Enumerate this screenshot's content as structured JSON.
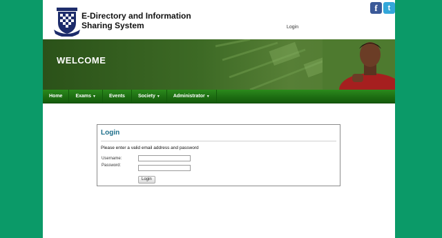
{
  "header": {
    "title": "E-Directory and Information Sharing System",
    "login_link": "Login",
    "social": {
      "facebook": "f",
      "twitter": "t"
    }
  },
  "banner": {
    "title": "WELCOME"
  },
  "nav": {
    "items": [
      {
        "label": "Home",
        "dropdown": false
      },
      {
        "label": "Exams",
        "dropdown": true
      },
      {
        "label": "Events",
        "dropdown": false
      },
      {
        "label": "Society",
        "dropdown": true
      },
      {
        "label": "Administrator",
        "dropdown": true
      }
    ]
  },
  "login": {
    "title": "Login",
    "message": "Please enter a valid email address and password",
    "username_label": "Username:",
    "password_label": "Password:",
    "username_value": "",
    "password_value": "",
    "button_label": "Login"
  },
  "colors": {
    "page_background": "#0b9a68",
    "nav_green": "#1d6d12",
    "banner_green": "#3d6a25",
    "login_title": "#1c6e8a",
    "facebook": "#3b5998",
    "twitter": "#33a7da"
  }
}
